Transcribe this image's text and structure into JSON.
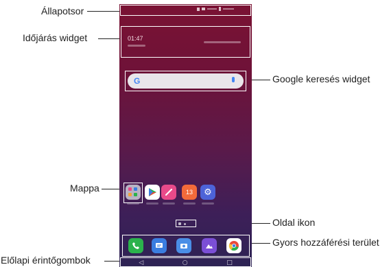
{
  "callouts": {
    "status_bar": "Állapotsor",
    "weather_widget": "Időjárás widget",
    "google_search_widget": "Google keresés widget",
    "folder": "Mappa",
    "page_icon": "Oldal ikon",
    "quick_access_area": "Gyors hozzáférési terület",
    "home_touch_buttons": "Előlapi érintőgombok"
  },
  "screen": {
    "clock": "01:47",
    "search_logo": "G"
  },
  "icons": {
    "folder": "folder-icon",
    "play_store": "play-store-icon",
    "pen": "pen-app-icon",
    "calendar": "calendar-icon",
    "settings": "settings-gear-icon",
    "phone": "phone-icon",
    "messages": "messages-icon",
    "camera": "camera-icon",
    "gallery": "gallery-icon",
    "chrome": "chrome-icon"
  },
  "calendar_day": "13",
  "navbar": {
    "back": "◁",
    "home": "○",
    "recents": "□"
  },
  "colors": {
    "screen_top": "#7a1233",
    "screen_bottom": "#2d2354",
    "phone_green": "#2bb24c",
    "messages_blue": "#3b7de0",
    "camera_blue": "#4a8ee6",
    "gallery_purple": "#7b4fd6",
    "calendar_orange": "#f36a3a",
    "pen_pink": "#e84a8a",
    "settings_blue": "#4d63d8"
  }
}
